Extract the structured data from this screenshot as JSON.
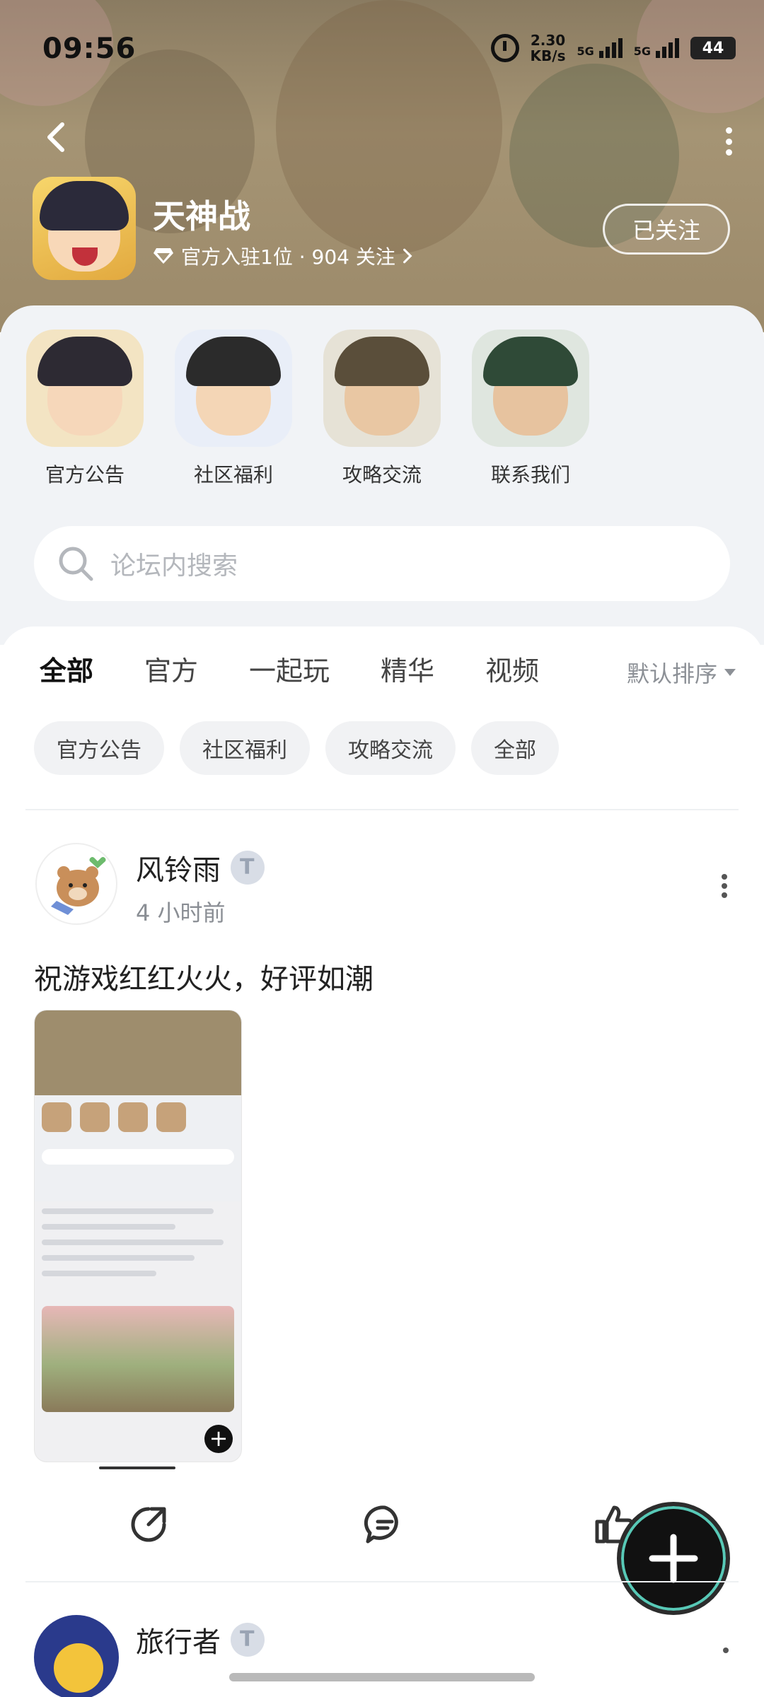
{
  "status_bar": {
    "time": "09:56",
    "net_speed_value": "2.30",
    "net_speed_unit": "KB/s",
    "sim1": "5G",
    "sim2": "5G",
    "battery": "44"
  },
  "header": {
    "title": "天神战",
    "meta": "官方入驻1位 · 904 关注",
    "follow_label": "已关注"
  },
  "entries": [
    {
      "label": "官方公告",
      "color": "#e9b65a"
    },
    {
      "label": "社区福利",
      "color": "#3b62c4"
    },
    {
      "label": "攻略交流",
      "color": "#5f6a4a"
    },
    {
      "label": "联系我们",
      "color": "#3c6b4a"
    }
  ],
  "search": {
    "placeholder": "论坛内搜索"
  },
  "tabs": [
    {
      "label": "全部",
      "active": true
    },
    {
      "label": "官方",
      "active": false
    },
    {
      "label": "一起玩",
      "active": false
    },
    {
      "label": "精华",
      "active": false
    },
    {
      "label": "视频",
      "active": false
    }
  ],
  "sort_label": "默认排序",
  "chips": [
    "官方公告",
    "社区福利",
    "攻略交流",
    "全部"
  ],
  "post": {
    "author": "风铃雨",
    "time": "4 小时前",
    "content": "祝游戏红红火火，好评如潮"
  },
  "post2": {
    "author": "旅行者"
  },
  "colors": {
    "accent": "#3ad1b5",
    "hero_bg": "#9c8a6a",
    "panel_bg": "#f1f3f6"
  },
  "icons": [
    "back-icon",
    "more-icon",
    "diamond-icon",
    "chevron-right-icon",
    "search-icon",
    "share-icon",
    "comment-icon",
    "like-icon",
    "plus-icon"
  ]
}
